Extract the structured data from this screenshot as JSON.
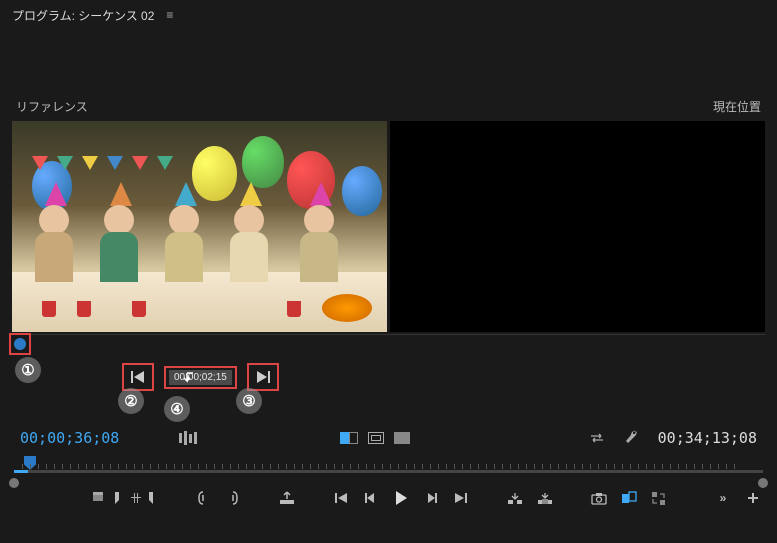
{
  "header": {
    "program_label": "プログラム: シーケンス 02"
  },
  "labels": {
    "reference": "リファレンス",
    "current_position": "現在位置"
  },
  "tooltip": {
    "offset_text": "00;00;02;15"
  },
  "timecodes": {
    "current": "00;00;36;08",
    "duration": "00;34;13;08"
  },
  "callouts": {
    "c1": "①",
    "c2": "②",
    "c3": "③",
    "c4": "④"
  },
  "colors": {
    "accent": "#3fa9f5",
    "highlight_border": "#d44"
  }
}
